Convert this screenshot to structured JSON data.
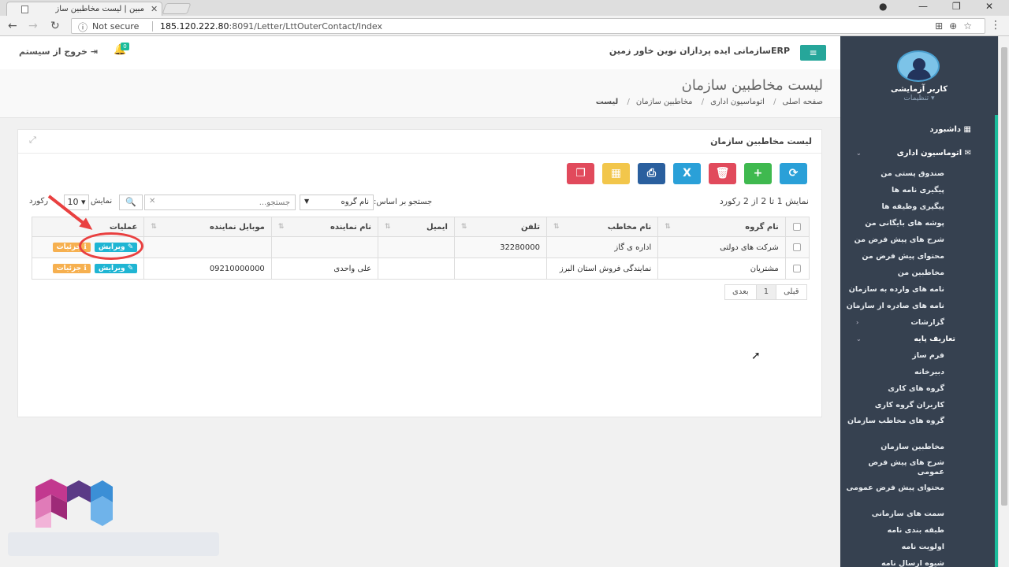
{
  "browser": {
    "tab_title": "مبین | لیست مخاطبین ساز",
    "not_secure": "Not secure",
    "url_host": "185.120.222.80",
    "url_path": ":8091/Letter/LttOuterContact/Index"
  },
  "header": {
    "logout_label": "خروج از سیستم",
    "notification_count": "0",
    "brand": "ERPسازمانی ایده پردازان نوین خاور زمین"
  },
  "page": {
    "title": "لیست مخاطبین سازمان",
    "breadcrumb": [
      "صفحه اصلی",
      "اتوماسیون اداری",
      "مخاطبین سازمان",
      "لیست"
    ]
  },
  "panel": {
    "title": "لیست مخاطبین سازمان",
    "info": "نمایش 1 تا 2 از 2 رکورد",
    "search_label": "جستجو بر اساس:",
    "search_field": "نام گروه",
    "search_placeholder": "جستجو...",
    "length_label": "نمایش",
    "length_value": "10",
    "records_label": "رکورد"
  },
  "toolbar": {
    "colors": {
      "refresh": "#2aa0d8",
      "add": "#3fb94f",
      "delete": "#e14a5c",
      "excel": "#2aa0d8",
      "print": "#2a5f9e",
      "columns": "#f2c64b",
      "copy": "#e14a5c"
    }
  },
  "table": {
    "headers": [
      "نام گروه",
      "نام مخاطب",
      "تلفن",
      "ایمیل",
      "نام نماینده",
      "موبایل نماینده",
      "عملیات"
    ],
    "rows": [
      {
        "group": "شرکت های دولتی",
        "contact": "اداره ی گاز",
        "phone": "32280000",
        "email": "",
        "rep": "",
        "mobile": ""
      },
      {
        "group": "مشتریان",
        "contact": "نمایندگی فروش استان البرز",
        "phone": "",
        "email": "",
        "rep": "علی واحدی",
        "mobile": "09210000000"
      }
    ],
    "edit_label": "ویرایش",
    "detail_label": "جزئیات"
  },
  "pager": {
    "prev": "قبلی",
    "page": "1",
    "next": "بعدی"
  },
  "sidebar": {
    "user_name": "کاربر آزمایشی",
    "user_settings": "تنظیمات",
    "dashboard": "داشبورد",
    "office": "اتوماسیون اداری",
    "office_items": [
      "صندوق پستی من",
      "پیگیری نامه ها",
      "پیگیری وظیفه ها",
      "پوشه های بایگانی من",
      "شرح های پیش فرض من",
      "محتوای پیش فرض من",
      "مخاطبین من",
      "نامه های وارده به سازمان",
      "نامه های صادره از سازمان",
      "گزارشات"
    ],
    "base": "تعاریف پایه",
    "base_items": [
      "فرم ساز",
      "دبیرخانه",
      "گروه های کاری",
      "کاربران گروه کاری",
      "گروه های مخاطب سازمان",
      "مخاطبین سازمان",
      "شرح های پیش فرض عمومی",
      "محتوای پیش فرض عمومی",
      "سمت های سازمانی",
      "طبقه بندی نامه",
      "اولویت نامه",
      "شیوه ارسال نامه"
    ]
  }
}
